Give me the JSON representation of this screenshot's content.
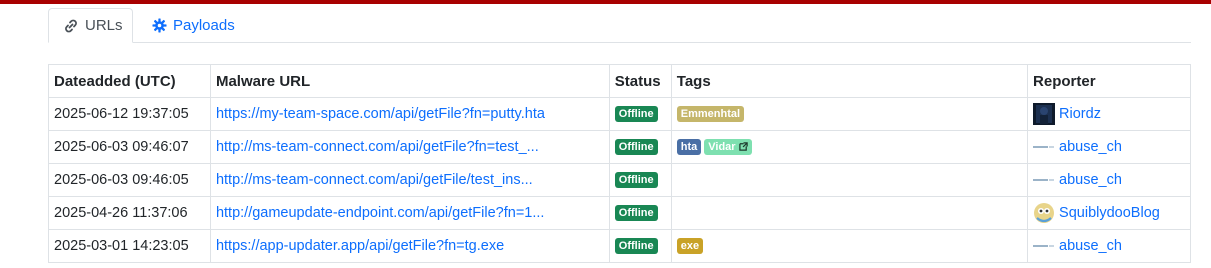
{
  "tabs": [
    {
      "label": "URLs",
      "icon": "link-icon",
      "active": true
    },
    {
      "label": "Payloads",
      "icon": "gear-icon",
      "active": false
    }
  ],
  "table": {
    "headers": [
      "Dateadded (UTC)",
      "Malware URL",
      "Status",
      "Tags",
      "Reporter"
    ],
    "rows": [
      {
        "date": "2025-06-12 19:37:05",
        "url": "https://my-team-space.com/api/getFile?fn=putty.hta",
        "status": "Offline",
        "tags": [
          {
            "label": "Emmenhtal",
            "color": "#c5b66a"
          }
        ],
        "reporter": "Riordz",
        "avatar": "riordz-avatar"
      },
      {
        "date": "2025-06-03 09:46:07",
        "url": "http://ms-team-connect.com/api/getFile?fn=test_...",
        "status": "Offline",
        "tags": [
          {
            "label": "hta",
            "color": "#4a6fa5"
          },
          {
            "label": "Vidar",
            "color": "#7ee0b0",
            "external": true
          }
        ],
        "reporter": "abuse_ch",
        "avatar": "abuse-ch-logo"
      },
      {
        "date": "2025-06-03 09:46:05",
        "url": "http://ms-team-connect.com/api/getFile/test_ins...",
        "status": "Offline",
        "tags": [],
        "reporter": "abuse_ch",
        "avatar": "abuse-ch-logo"
      },
      {
        "date": "2025-04-26 11:37:06",
        "url": "http://gameupdate-endpoint.com/api/getFile?fn=1...",
        "status": "Offline",
        "tags": [],
        "reporter": "SquiblydooBlog",
        "avatar": "squiblydoo-avatar"
      },
      {
        "date": "2025-03-01 14:23:05",
        "url": "https://app-updater.app/api/getFile?fn=tg.exe",
        "status": "Offline",
        "tags": [
          {
            "label": "exe",
            "color": "#c9a227"
          }
        ],
        "reporter": "abuse_ch",
        "avatar": "abuse-ch-logo"
      }
    ]
  },
  "colors": {
    "accent": "#0d6efd",
    "topbar": "#a80000",
    "offline": "#198754"
  }
}
